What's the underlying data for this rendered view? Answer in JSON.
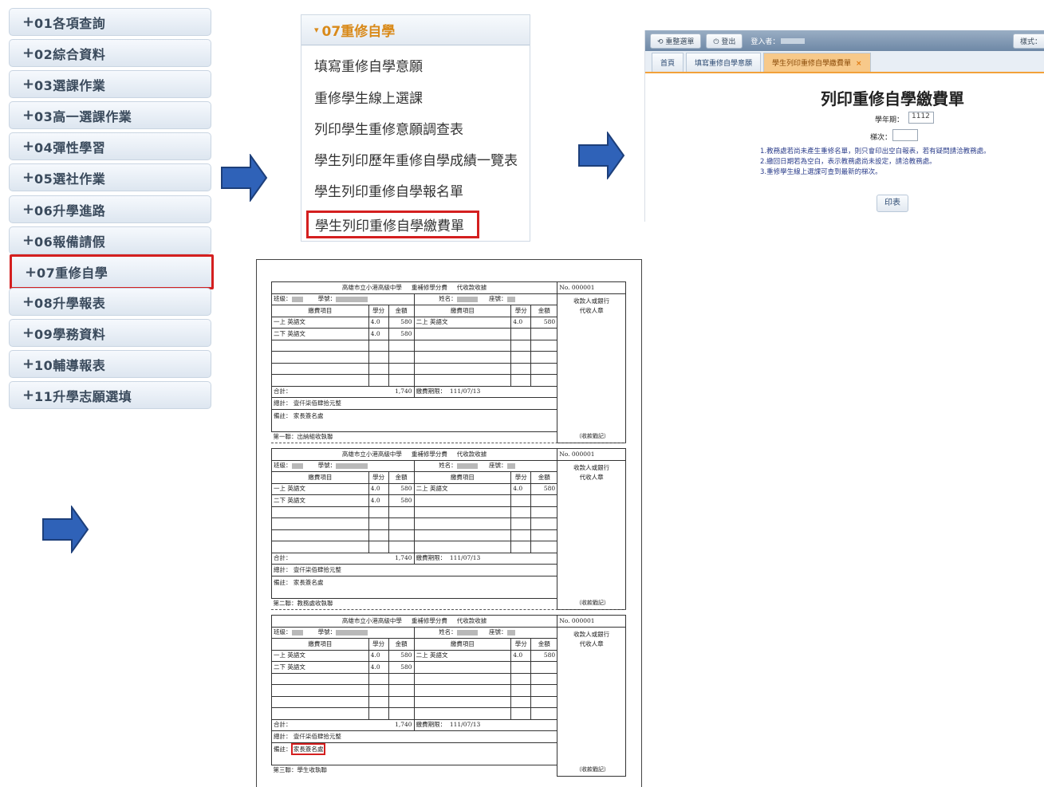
{
  "menu": {
    "items": [
      {
        "label": "01各項查詢"
      },
      {
        "label": "02綜合資料"
      },
      {
        "label": "03選課作業"
      },
      {
        "label": "03高一選課作業"
      },
      {
        "label": "04彈性學習"
      },
      {
        "label": "05選社作業"
      },
      {
        "label": "06升學進路"
      },
      {
        "label": "06報備請假"
      },
      {
        "label": "07重修自學",
        "active": true
      },
      {
        "label": "08升學報表"
      },
      {
        "label": "09學務資料"
      },
      {
        "label": "10輔導報表"
      },
      {
        "label": "11升學志願選填"
      }
    ],
    "plus": "+"
  },
  "submenu": {
    "header": "07重修自學",
    "caret": "▾",
    "items": [
      "填寫重修自學意願",
      "重修學生線上選課",
      "列印學生重修意願調查表",
      "學生列印歷年重修自學成績一覽表",
      "學生列印重修自學報名單",
      "學生列印重修自學繳費單"
    ],
    "highlighted_index": 5
  },
  "webform": {
    "topbar": {
      "reselect": "重整選單",
      "logout": "登出",
      "login_user": "登入者：",
      "style": "樣式："
    },
    "tabs": [
      "首頁",
      "填寫重修自學意願",
      "學生列印重修自學繳費單"
    ],
    "tab_close": "×",
    "title": "列印重修自學繳費單",
    "semester_label": "學年期：",
    "semester_value": "1112",
    "round_label": "梯次：",
    "round_value": "",
    "notes": [
      "1.教務處若尚未產生重修名單，則只會印出空白報表，若有疑問請洽教務處。",
      "2.繳回日期若為空白，表示教務處尚未設定，請洽教務處。",
      "3.重修學生線上選課可查到最新的梯次。"
    ],
    "print_button": "印表"
  },
  "receipt": {
    "school": "高雄市立小港高級中學",
    "fee_title": "重補修學分費",
    "type": "代收款收據",
    "number": "No. 000001",
    "class_label": "班級：",
    "student_id_label": "學號：",
    "name_label": "姓名：",
    "seat_label": "座號：",
    "bank_line1": "收款人或銀行",
    "bank_line2": "代收人章",
    "col_item": "繳費項目",
    "col_credit": "學分",
    "col_amount": "金額",
    "rows_left": [
      {
        "item": "一上 英語文",
        "credit": "4.0",
        "amount": "580"
      },
      {
        "item": "二下 英語文",
        "credit": "4.0",
        "amount": "580"
      }
    ],
    "rows_right": [
      {
        "item": "二上 英語文",
        "credit": "4.0",
        "amount": "580"
      }
    ],
    "subtotal_label": "合計：",
    "subtotal": "1,740",
    "deadline_label": "繳費期限：",
    "deadline": "111/07/13",
    "total_label": "總計：",
    "total_words": "壹仟柒佰肆拾元整",
    "remark_label": "備註：",
    "remark": "家長簽名處",
    "receipt_stamp": "（收款戳記）",
    "copies": [
      "第一聯：出納組收執聯",
      "第二聯：教務處收執聯",
      "第三聯：學生收執聯"
    ]
  }
}
